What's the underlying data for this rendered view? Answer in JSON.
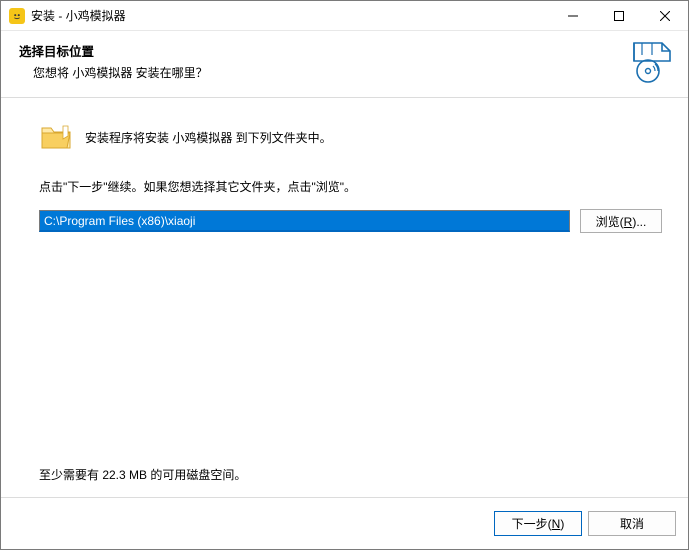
{
  "titlebar": {
    "title": "安装 - 小鸡模拟器"
  },
  "header": {
    "title": "选择目标位置",
    "subtitle": "您想将 小鸡模拟器 安装在哪里？"
  },
  "body": {
    "folder_line": "安装程序将安装 小鸡模拟器 到下列文件夹中。",
    "instruction": "点击\"下一步\"继续。如果您想选择其它文件夹，点击\"浏览\"。",
    "path_value": "C:\\Program Files (x86)\\xiaoji",
    "browse_btn_pre": "浏览(",
    "browse_btn_mnemonic": "R",
    "browse_btn_post": ")...",
    "diskspace": "至少需要有 22.3 MB 的可用磁盘空间。"
  },
  "footer": {
    "next_pre": "下一步(",
    "next_mnemonic": "N",
    "next_post": ")",
    "cancel": "取消"
  }
}
